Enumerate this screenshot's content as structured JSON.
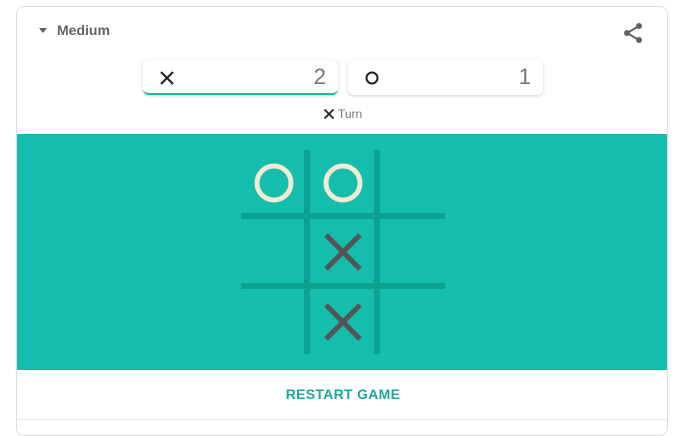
{
  "header": {
    "difficulty_label": "Medium",
    "share_icon": "share-icon"
  },
  "scores": {
    "x": {
      "symbol": "X",
      "value": "2"
    },
    "o": {
      "symbol": "O",
      "value": "1"
    }
  },
  "turn": {
    "symbol": "X",
    "label": "Turn"
  },
  "board": {
    "cells": [
      "O",
      "O",
      "",
      "",
      "X",
      "",
      "",
      "X",
      ""
    ]
  },
  "footer": {
    "restart_label": "RESTART GAME"
  },
  "colors": {
    "board_bg": "#14bdac",
    "grid_line": "#0da192",
    "x_mark": "#545454",
    "o_mark": "#f2ebd3",
    "accent": "#19b8a7"
  }
}
